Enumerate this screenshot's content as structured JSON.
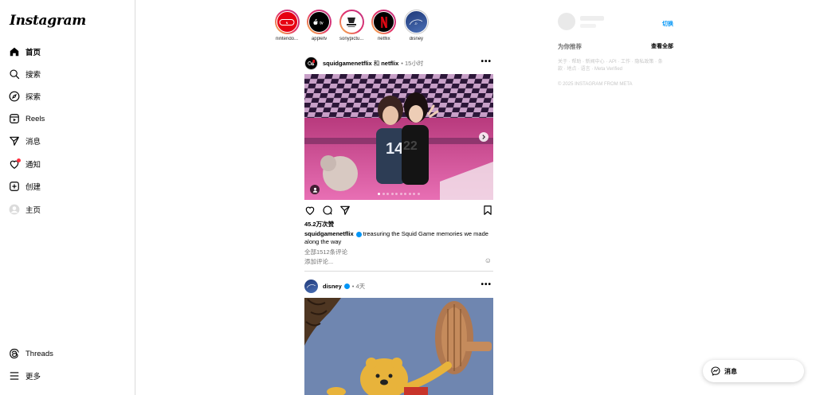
{
  "sidebar": {
    "logo": "Instagram",
    "items": [
      {
        "label": "首页",
        "icon": "home-icon"
      },
      {
        "label": "搜索",
        "icon": "search-icon"
      },
      {
        "label": "探索",
        "icon": "compass-icon"
      },
      {
        "label": "Reels",
        "icon": "reels-icon"
      },
      {
        "label": "消息",
        "icon": "send-icon"
      },
      {
        "label": "通知",
        "icon": "heart-icon"
      },
      {
        "label": "创建",
        "icon": "plus-square-icon"
      },
      {
        "label": "主页",
        "icon": "profile-avatar-icon"
      }
    ],
    "bottom": [
      {
        "label": "Threads",
        "icon": "threads-icon"
      },
      {
        "label": "更多",
        "icon": "menu-icon"
      }
    ]
  },
  "stories": [
    {
      "name": "nintendo...",
      "seen": false
    },
    {
      "name": "appletv",
      "seen": false
    },
    {
      "name": "sonypictu...",
      "seen": false
    },
    {
      "name": "netflix",
      "seen": false
    },
    {
      "name": "disney",
      "seen": true
    }
  ],
  "posts": [
    {
      "author": "squidgamenetflix",
      "coauthor_joiner": "和",
      "coauthor": "netflix",
      "time": "• 15小时",
      "likes": "45.2万次赞",
      "caption_user": "squidgamenetflix",
      "caption_text": "treasuring the Squid Game memories we made along the way",
      "comments_link": "全部1512条评论",
      "add_comment_placeholder": "添加评论...",
      "carousel_count": 10,
      "carousel_index": 0
    },
    {
      "author": "disney",
      "time": "• 4天"
    }
  ],
  "right": {
    "switch_label": "切换",
    "suggest_title": "为你推荐",
    "see_all": "查看全部",
    "footer_links": "关于 · 帮助 · 新闻中心 · API · 工作 · 隐私政策 · 条款 · 地点 · 语言 · Meta Verified",
    "copyright": "© 2025 INSTAGRAM FROM META"
  },
  "messages_button": "消息",
  "colors": {
    "accent": "#0095f6",
    "story_ring": "#e1306c",
    "notification_dot": "#ff3040"
  }
}
